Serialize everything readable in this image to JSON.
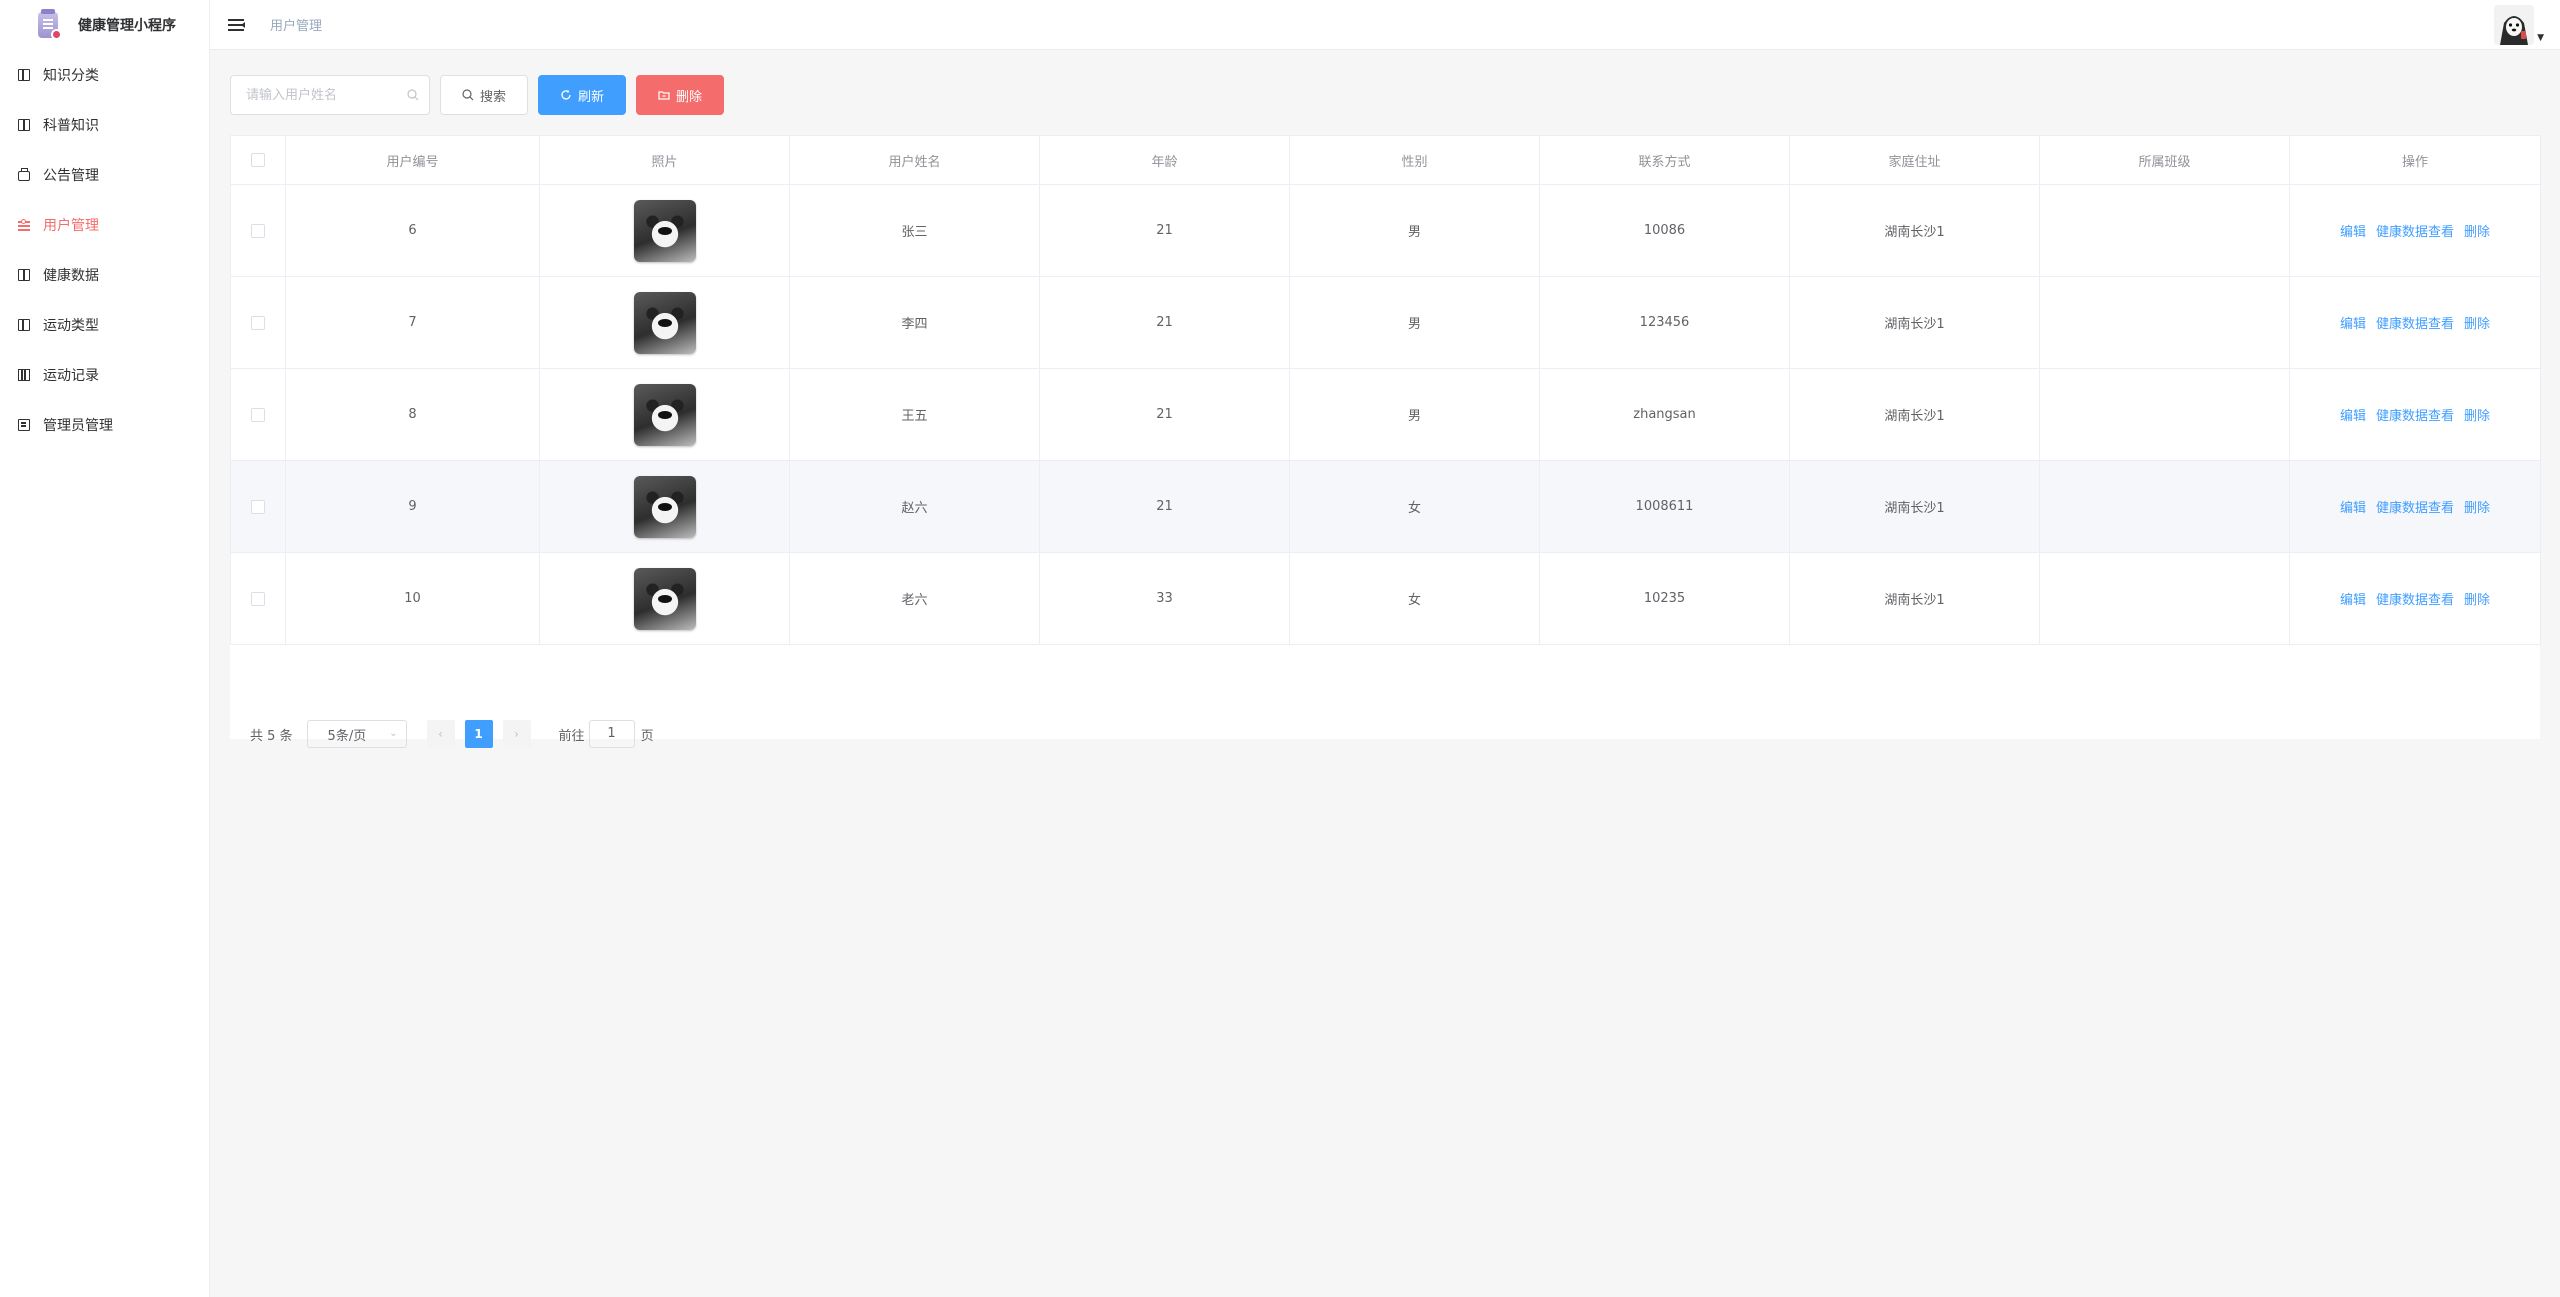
{
  "app": {
    "title": "健康管理小程序"
  },
  "sidebar": {
    "items": [
      {
        "label": "知识分类",
        "icon": "book-icon"
      },
      {
        "label": "科普知识",
        "icon": "open-book-icon"
      },
      {
        "label": "公告管理",
        "icon": "briefcase-icon"
      },
      {
        "label": "用户管理",
        "icon": "sliders-icon",
        "active": true
      },
      {
        "label": "健康数据",
        "icon": "open-book-icon"
      },
      {
        "label": "运动类型",
        "icon": "book-icon"
      },
      {
        "label": "运动记录",
        "icon": "columns-icon"
      },
      {
        "label": "管理员管理",
        "icon": "notebook-icon"
      }
    ]
  },
  "header": {
    "breadcrumb": "用户管理"
  },
  "toolbar": {
    "search_placeholder": "请输入用户姓名",
    "search_label": "搜索",
    "refresh_label": "刷新",
    "delete_label": "删除"
  },
  "table": {
    "headers": [
      "用户编号",
      "照片",
      "用户姓名",
      "年龄",
      "性别",
      "联系方式",
      "家庭住址",
      "所属班级",
      "操作"
    ],
    "rows": [
      {
        "id": "6",
        "name": "张三",
        "age": "21",
        "gender": "男",
        "contact": "10086",
        "address": "湖南长沙1",
        "class": ""
      },
      {
        "id": "7",
        "name": "李四",
        "age": "21",
        "gender": "男",
        "contact": "123456",
        "address": "湖南长沙1",
        "class": ""
      },
      {
        "id": "8",
        "name": "王五",
        "age": "21",
        "gender": "男",
        "contact": "zhangsan",
        "address": "湖南长沙1",
        "class": ""
      },
      {
        "id": "9",
        "name": "赵六",
        "age": "21",
        "gender": "女",
        "contact": "1008611",
        "address": "湖南长沙1",
        "class": ""
      },
      {
        "id": "10",
        "name": "老六",
        "age": "33",
        "gender": "女",
        "contact": "10235",
        "address": "湖南长沙1",
        "class": ""
      }
    ],
    "ops": {
      "edit": "编辑",
      "health": "健康数据查看",
      "delete": "删除"
    }
  },
  "pagination": {
    "total": "共 5 条",
    "page_size": "5条/页",
    "prev": "‹",
    "next": "›",
    "current": "1",
    "goto_label": "前往",
    "goto_value": "1",
    "page_suffix": "页"
  },
  "colors": {
    "primary": "#409eff",
    "danger": "#f56c6c",
    "active_menu": "#f56c6c"
  }
}
